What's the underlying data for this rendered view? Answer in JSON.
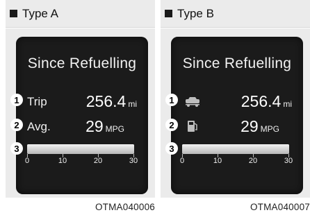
{
  "panels": [
    {
      "title": "Type A",
      "heading": "Since Refuelling",
      "rows": [
        {
          "badge": "1",
          "label": "Trip",
          "value": "256.4",
          "unit": "mi"
        },
        {
          "badge": "2",
          "label": "Avg.",
          "value": "29",
          "unit": "MPG"
        }
      ],
      "gauge": {
        "badge": "3",
        "ticks": [
          "0",
          "10",
          "20",
          "30"
        ],
        "range": [
          0,
          30
        ],
        "level": 30
      },
      "caption": "OTMA040006"
    },
    {
      "title": "Type B",
      "heading": "Since Refuelling",
      "rows": [
        {
          "badge": "1",
          "icon": "car-icon",
          "value": "256.4",
          "unit": "mi"
        },
        {
          "badge": "2",
          "icon": "fuel-pump-icon",
          "value": "29",
          "unit": "MPG"
        }
      ],
      "gauge": {
        "badge": "3",
        "ticks": [
          "0",
          "10",
          "20",
          "30"
        ],
        "range": [
          0,
          30
        ],
        "level": 30
      },
      "caption": "OTMA040007"
    }
  ]
}
